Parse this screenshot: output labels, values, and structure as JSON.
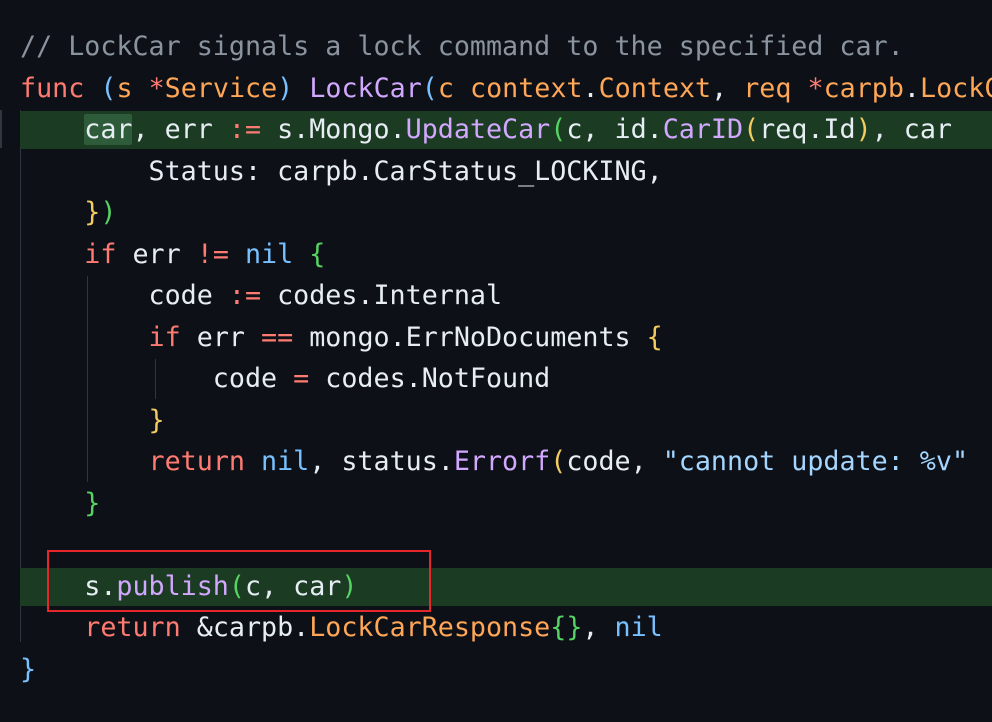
{
  "code": {
    "lines": [
      [
        {
          "t": "// LockCar signals a lock command to the specified car.",
          "c": "comment"
        }
      ],
      [
        {
          "t": "func",
          "c": "kw"
        },
        {
          "t": " ",
          "c": "plain"
        },
        {
          "t": "(",
          "c": "b1"
        },
        {
          "t": "s",
          "c": "param"
        },
        {
          "t": " ",
          "c": "plain"
        },
        {
          "t": "*",
          "c": "op"
        },
        {
          "t": "Service",
          "c": "ty"
        },
        {
          "t": ")",
          "c": "b1"
        },
        {
          "t": " ",
          "c": "plain"
        },
        {
          "t": "LockCar",
          "c": "fn"
        },
        {
          "t": "(",
          "c": "b1"
        },
        {
          "t": "c",
          "c": "param"
        },
        {
          "t": " ",
          "c": "plain"
        },
        {
          "t": "context",
          "c": "ty"
        },
        {
          "t": ".",
          "c": "plain"
        },
        {
          "t": "Context",
          "c": "ty"
        },
        {
          "t": ", ",
          "c": "plain"
        },
        {
          "t": "req",
          "c": "param"
        },
        {
          "t": " ",
          "c": "plain"
        },
        {
          "t": "*",
          "c": "op"
        },
        {
          "t": "carpb",
          "c": "ty"
        },
        {
          "t": ".",
          "c": "plain"
        },
        {
          "t": "LockCarRequest",
          "c": "ty"
        }
      ],
      [
        {
          "t": "    ",
          "c": "plain"
        },
        {
          "t": "car",
          "c": "plain",
          "hw": true
        },
        {
          "t": ", err ",
          "c": "plain"
        },
        {
          "t": ":=",
          "c": "op"
        },
        {
          "t": " s.Mongo.",
          "c": "plain"
        },
        {
          "t": "UpdateCar",
          "c": "fn"
        },
        {
          "t": "(",
          "c": "b3"
        },
        {
          "t": "c, id.",
          "c": "plain"
        },
        {
          "t": "CarID",
          "c": "fn"
        },
        {
          "t": "(",
          "c": "b2"
        },
        {
          "t": "req.Id",
          "c": "plain"
        },
        {
          "t": ")",
          "c": "b2"
        },
        {
          "t": ", car",
          "c": "plain"
        }
      ],
      [
        {
          "t": "        Status: carpb.CarStatus_LOCKING,",
          "c": "plain"
        }
      ],
      [
        {
          "t": "    ",
          "c": "plain"
        },
        {
          "t": "}",
          "c": "b2"
        },
        {
          "t": ")",
          "c": "b3"
        }
      ],
      [
        {
          "t": "    ",
          "c": "plain"
        },
        {
          "t": "if",
          "c": "kw"
        },
        {
          "t": " err ",
          "c": "plain"
        },
        {
          "t": "!=",
          "c": "op"
        },
        {
          "t": " ",
          "c": "plain"
        },
        {
          "t": "nil",
          "c": "lit"
        },
        {
          "t": " ",
          "c": "plain"
        },
        {
          "t": "{",
          "c": "b3"
        }
      ],
      [
        {
          "t": "        code ",
          "c": "plain"
        },
        {
          "t": ":=",
          "c": "op"
        },
        {
          "t": " codes.Internal",
          "c": "plain"
        }
      ],
      [
        {
          "t": "        ",
          "c": "plain"
        },
        {
          "t": "if",
          "c": "kw"
        },
        {
          "t": " err ",
          "c": "plain"
        },
        {
          "t": "==",
          "c": "op"
        },
        {
          "t": " mongo.ErrNoDocuments ",
          "c": "plain"
        },
        {
          "t": "{",
          "c": "b2"
        }
      ],
      [
        {
          "t": "            code ",
          "c": "plain"
        },
        {
          "t": "=",
          "c": "op"
        },
        {
          "t": " codes.NotFound",
          "c": "plain"
        }
      ],
      [
        {
          "t": "        ",
          "c": "plain"
        },
        {
          "t": "}",
          "c": "b2"
        }
      ],
      [
        {
          "t": "        ",
          "c": "plain"
        },
        {
          "t": "return",
          "c": "kw"
        },
        {
          "t": " ",
          "c": "plain"
        },
        {
          "t": "nil",
          "c": "lit"
        },
        {
          "t": ", status.",
          "c": "plain"
        },
        {
          "t": "Errorf",
          "c": "fn"
        },
        {
          "t": "(",
          "c": "b2"
        },
        {
          "t": "code, ",
          "c": "plain"
        },
        {
          "t": "\"cannot update: %v\"",
          "c": "str"
        }
      ],
      [
        {
          "t": "    ",
          "c": "plain"
        },
        {
          "t": "}",
          "c": "b3"
        }
      ],
      [
        {
          "t": "",
          "c": "plain"
        }
      ],
      [
        {
          "t": "    s.",
          "c": "plain"
        },
        {
          "t": "publish",
          "c": "fn"
        },
        {
          "t": "(",
          "c": "b3"
        },
        {
          "t": "c, car",
          "c": "plain"
        },
        {
          "t": ")",
          "c": "b3"
        }
      ],
      [
        {
          "t": "    ",
          "c": "plain"
        },
        {
          "t": "return",
          "c": "kw"
        },
        {
          "t": " &carpb.",
          "c": "plain"
        },
        {
          "t": "LockCarResponse",
          "c": "ty"
        },
        {
          "t": "{}",
          "c": "b3"
        },
        {
          "t": ", ",
          "c": "plain"
        },
        {
          "t": "nil",
          "c": "lit"
        }
      ],
      [
        {
          "t": "}",
          "c": "b1"
        }
      ]
    ],
    "highlighted_lines": [
      2,
      13
    ]
  },
  "theme": {
    "background": "#0d1117",
    "line_highlight": "#1b3b23",
    "annotation_box": "#e5262b"
  }
}
